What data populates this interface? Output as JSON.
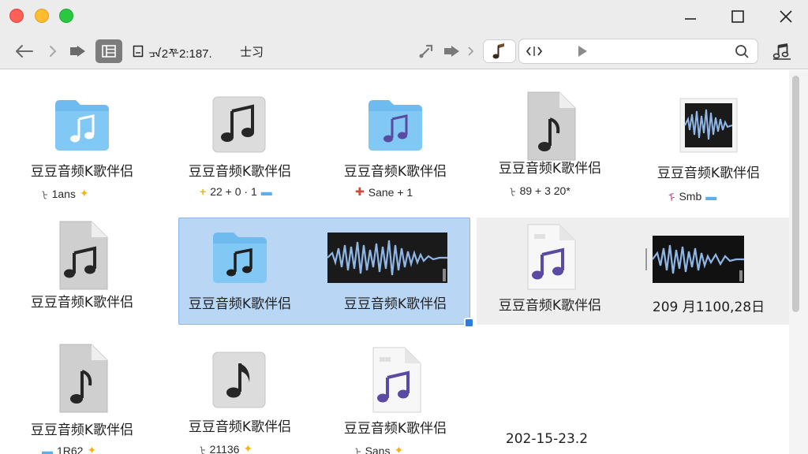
{
  "window": {
    "colors": {
      "close": "#fe5f57",
      "minimize": "#febc2e",
      "zoom": "#28c840",
      "selection": "#b9d6f5"
    }
  },
  "toolbar": {
    "path_text": "ᠠ ᠪ2ᢝ2:187.",
    "path_label": "ᠴᠠ2ᢝ2:187.",
    "sort_label": "士习",
    "search_value": "‹ᢢ",
    "icons": [
      "back-arrow-icon",
      "forward-arrow-icon",
      "share-icon",
      "gallery-view-icon",
      "music-note-icon",
      "search-icon",
      "audio-settings-icon"
    ]
  },
  "items": [
    {
      "name": "豆豆音频K歌伴侣",
      "meta": "1ans",
      "icon": "music-folder-icon"
    },
    {
      "name": "豆豆音频K歌伴侣",
      "meta": "22 + 0 · 1",
      "icon": "music-file-dark-icon"
    },
    {
      "name": "豆豆音频K歌伴侣",
      "meta": "Sane + 1",
      "icon": "music-folder-purple-icon"
    },
    {
      "name": "豆豆音频K歌伴侣",
      "meta": "89 + 3  20*",
      "icon": "music-document-icon"
    },
    {
      "name": "豆豆音频K歌伴侣",
      "meta": "Smb",
      "icon": "waveform-icon"
    },
    {
      "name": "豆豆音频K歌伴侣",
      "meta": "",
      "icon": "music-document-icon"
    },
    {
      "name": "豆豆音频K歌伴侣",
      "meta": "",
      "icon": "music-folder-icon"
    },
    {
      "name": "豆豆音频K歌伴侣",
      "meta": "",
      "icon": "waveform-icon"
    },
    {
      "name": "豆豆音频K歌伴侣",
      "meta": "",
      "icon": "music-document-purple-icon"
    },
    {
      "name": "209 月1100,28日",
      "meta": "",
      "icon": "waveform-icon"
    },
    {
      "name": "豆豆音频K歌伴侣",
      "meta": "1R62",
      "icon": "music-document-icon"
    },
    {
      "name": "豆豆音频K歌伴侣",
      "meta": "21136",
      "icon": "music-file-dark-icon"
    },
    {
      "name": "豆豆音频K歌伴侣",
      "meta": "Sans",
      "icon": "music-document-purple-icon"
    },
    {
      "name": "202-15-23.2",
      "meta": "",
      "icon": ""
    }
  ]
}
